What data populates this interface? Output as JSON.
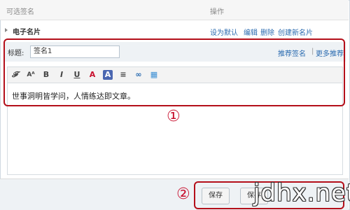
{
  "header": {
    "col_signature": "可选签名",
    "col_actions": "操作"
  },
  "signature_row": {
    "name": "电子名片",
    "actions": [
      "设为默认",
      "编辑",
      "删除",
      "创建新名片"
    ]
  },
  "editor": {
    "title_label": "标题:",
    "title_value": "签名1",
    "recommend_link": "推荐签名",
    "separator": "|",
    "more_recommend_link": "更多推荐",
    "toolbar": [
      "font-family-icon",
      "font-size-icon",
      "bold-icon",
      "italic-icon",
      "underline-icon",
      "font-color-icon",
      "highlight-color-icon",
      "align-icon",
      "link-icon",
      "image-icon"
    ],
    "toolbar_glyphs": {
      "font_family": "𝓕",
      "font_size": "Aᴬ",
      "bold": "B",
      "italic": "I",
      "underline": "U",
      "font_color": "A",
      "highlight": "A",
      "align": "≡",
      "link": "∞",
      "image": "▦"
    },
    "content": "世事洞明皆学问，人情练达即文章。"
  },
  "markers": {
    "first": "①",
    "second": "②"
  },
  "buttons": {
    "save": "保存",
    "save_second": "保存"
  },
  "watermark": "jdhx.net",
  "colors": {
    "link": "#2a6bb0",
    "highlight_red": "#b40f1a",
    "marker_red": "#c8102e"
  }
}
